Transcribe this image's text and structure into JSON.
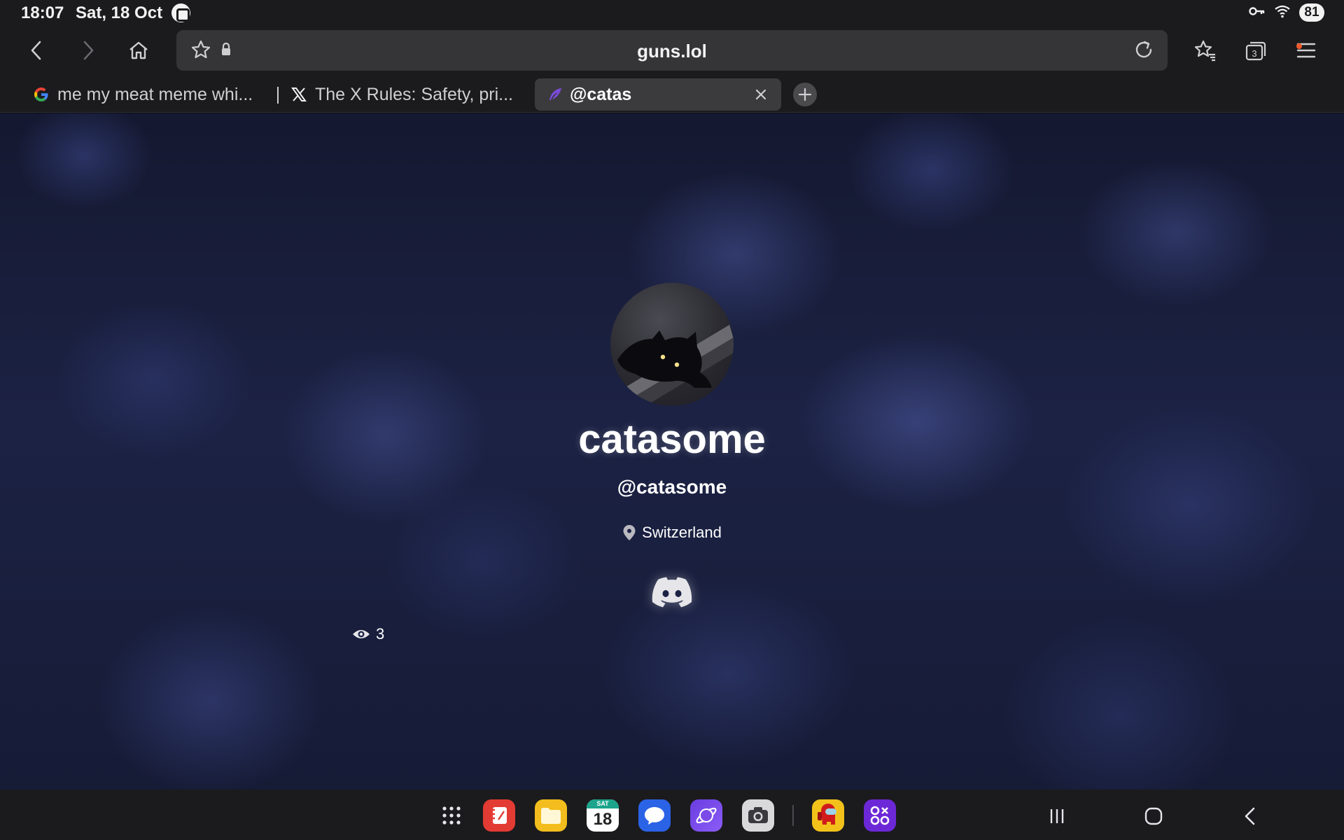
{
  "status": {
    "time": "18:07",
    "date": "Sat, 18 Oct",
    "battery": "81"
  },
  "browser": {
    "url": "guns.lol",
    "tab_count": "3",
    "tabs": [
      {
        "title": "me my meat meme whi...",
        "icon": "google-icon"
      },
      {
        "title": "The X Rules: Safety, pri...",
        "icon": "x-logo-icon"
      },
      {
        "title": "@catas",
        "icon": "feather-icon",
        "active": true
      }
    ]
  },
  "profile": {
    "display_name": "catasome",
    "handle": "@catasome",
    "location": "Switzerland",
    "views": "3"
  },
  "taskbar": {
    "calendar_day": "18",
    "calendar_weekday": "SAT"
  },
  "colors": {
    "accent_purple": "#7a4bd8",
    "background_navy": "#1c2244",
    "chrome_dark": "#1b1b1d"
  }
}
